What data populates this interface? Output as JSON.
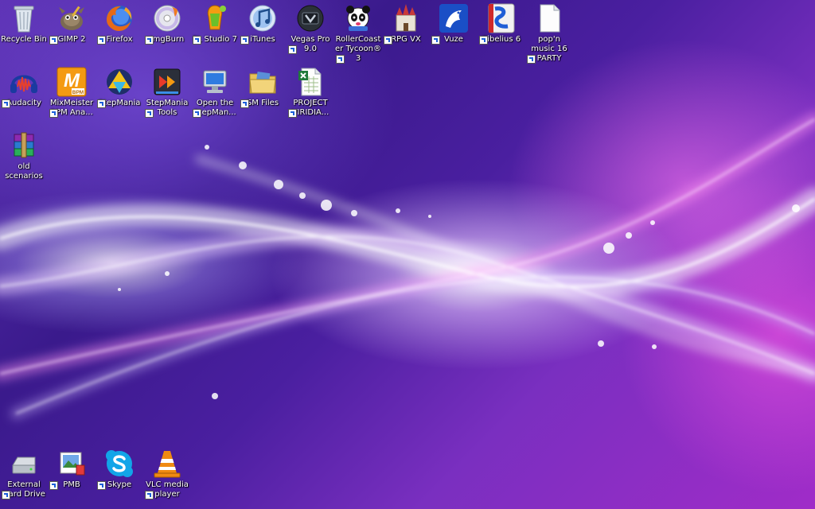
{
  "desktop": {
    "row1": [
      {
        "label": "Recycle Bin"
      },
      {
        "label": "GIMP 2"
      },
      {
        "label": "Firefox"
      },
      {
        "label": "ImgBurn"
      },
      {
        "label": "FL Studio 7"
      },
      {
        "label": "iTunes"
      },
      {
        "label": "Vegas Pro 9.0"
      },
      {
        "label": "RollerCoaster Tycoon® 3"
      },
      {
        "label": "RPG VX"
      },
      {
        "label": "Vuze"
      },
      {
        "label": "Sibelius 6"
      },
      {
        "label": "pop'n music 16 PARTY"
      }
    ],
    "row2": [
      {
        "label": "Audacity"
      },
      {
        "label": "MixMeister BPM Ana..."
      },
      {
        "label": "StepMania"
      },
      {
        "label": "StepMania Tools"
      },
      {
        "label": "Open the StepMan..."
      },
      {
        "label": "SM Files"
      },
      {
        "label": "PROJECT VIRIDIA..."
      }
    ],
    "row3": [
      {
        "label": "old scenarios"
      }
    ],
    "bottom": [
      {
        "label": "External Hard Drive"
      },
      {
        "label": "PMB"
      },
      {
        "label": "Skype"
      },
      {
        "label": "VLC media player"
      }
    ],
    "icon_glyphs": {
      "mixmeister": "M",
      "mixmeister_badge": "BPM"
    }
  }
}
